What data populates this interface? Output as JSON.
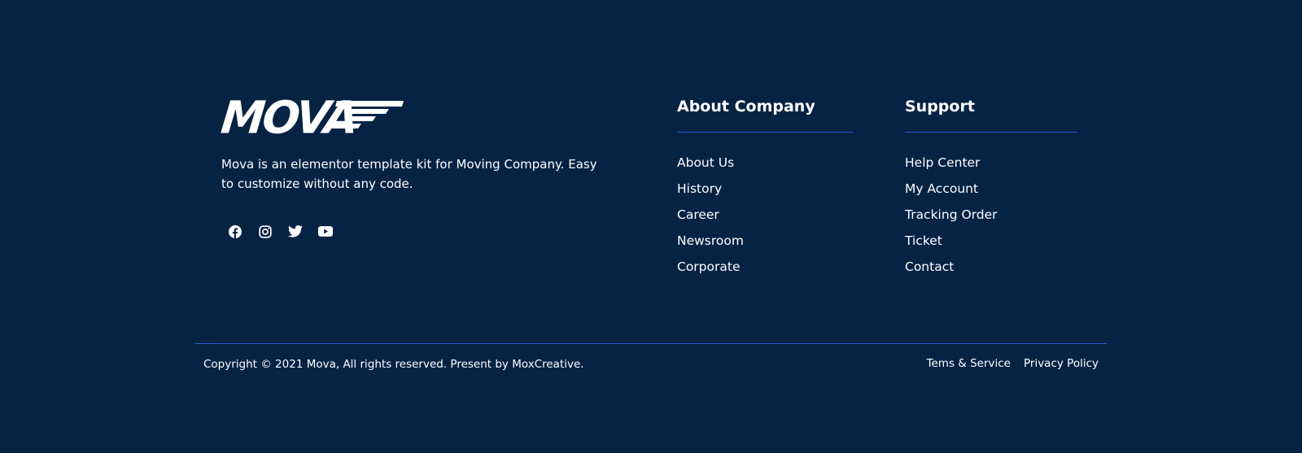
{
  "brand": {
    "logo_text": "MOVA",
    "description": "Mova is an elementor template kit for Moving Company. Easy to customize without any code.",
    "socials": [
      {
        "icon": "facebook-icon"
      },
      {
        "icon": "instagram-icon"
      },
      {
        "icon": "twitter-icon"
      },
      {
        "icon": "youtube-icon"
      }
    ]
  },
  "about": {
    "title": "About Company",
    "links": [
      "About Us",
      "History",
      "Career",
      "Newsroom",
      "Corporate"
    ]
  },
  "support": {
    "title": "Support",
    "links": [
      "Help Center",
      "My Account",
      "Tracking Order",
      "Ticket",
      "Contact"
    ]
  },
  "bottom": {
    "copyright": "Copyright © 2021 Mova, All rights reserved. Present by MoxCreative.",
    "terms": "Tems & Service",
    "privacy": "Privacy Policy"
  },
  "colors": {
    "background": "#062344",
    "accent_rule": "#2a5bd7",
    "text": "#ffffff"
  }
}
